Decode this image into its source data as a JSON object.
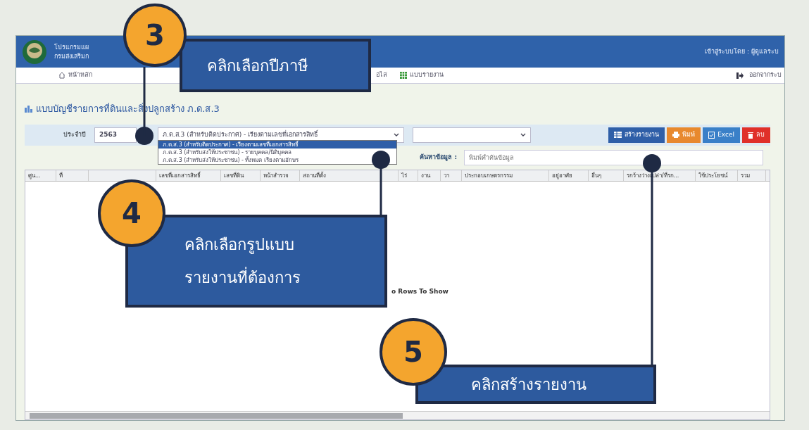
{
  "header": {
    "title_lines": [
      "โปรแกรมแผ",
      "กรมส่งเสริมก"
    ],
    "user": "เข้าสู่ระบบโดย : ผู้ดูแลระบ"
  },
  "nav": {
    "items": [
      {
        "label": "หน้าหลัก",
        "kind": "home"
      },
      {
        "label": "อไล่",
        "kind": "plain"
      },
      {
        "label": "แบบรายงาน",
        "kind": "report"
      }
    ],
    "logout": "ออกจากระบ"
  },
  "page_title": "แบบบัญชีรายการที่ดินและสิ่งปลูกสร้าง ภ.ด.ส.3",
  "filters": {
    "year_label": "ประจำปี",
    "year": "2563",
    "report_select": {
      "value": "ภ.ด.ส.3 (สำหรับติดประกาศ) - เรียงตามเลขที่เอกสารสิทธิ์",
      "expanded": true,
      "options": [
        {
          "label": "ภ.ด.ส.3 (สำหรับติดประกาศ) - เรียงตามเลขที่เอกสารสิทธิ์",
          "selected": true
        },
        {
          "label": "ภ.ด.ส.3 (สำหรับส่งให้ประชาชน) - รายบุคคล/นิติบุคคล",
          "selected": false
        },
        {
          "label": "ภ.ด.ส.3 (สำหรับส่งให้ประชาชน) - ทั้งหมด เรียงตามอักษร",
          "selected": false
        }
      ]
    }
  },
  "buttons": [
    {
      "label": "สร้างรายงาน",
      "kind": "create"
    },
    {
      "label": "พิมพ์",
      "kind": "print"
    },
    {
      "label": "Excel",
      "kind": "excel"
    },
    {
      "label": "ลบ",
      "kind": "delete"
    }
  ],
  "search": {
    "label": "ค้นหาข้อมูล :",
    "placeholder": "พิมพ์คำค้นข้อมูล"
  },
  "table": {
    "columns": [
      "ศูน...",
      "ที่",
      "",
      "เลขที่เอกสารสิทธิ์",
      "เลขที่ดิน",
      "หน้าสำรวจ",
      "สถานที่ตั้ง",
      "ไร่",
      "งาน",
      "วา",
      "ประกอบเกษตรกรรม",
      "อยู่อาศัย",
      "อื่นๆ",
      "รกร้างว่างเปล่า/ที่รก...",
      "ใช้ประโยชน์",
      "รวม"
    ],
    "empty_message": "o Rows To Show"
  },
  "callouts": [
    {
      "number": "3",
      "lines": [
        "คลิกเลือกปีภาษี"
      ]
    },
    {
      "number": "4",
      "lines": [
        "คลิกเลือกรูปแบบ",
        "รายงานที่ต้องการ"
      ]
    },
    {
      "number": "5",
      "lines": [
        "คลิกสร้างรายงาน"
      ]
    }
  ]
}
